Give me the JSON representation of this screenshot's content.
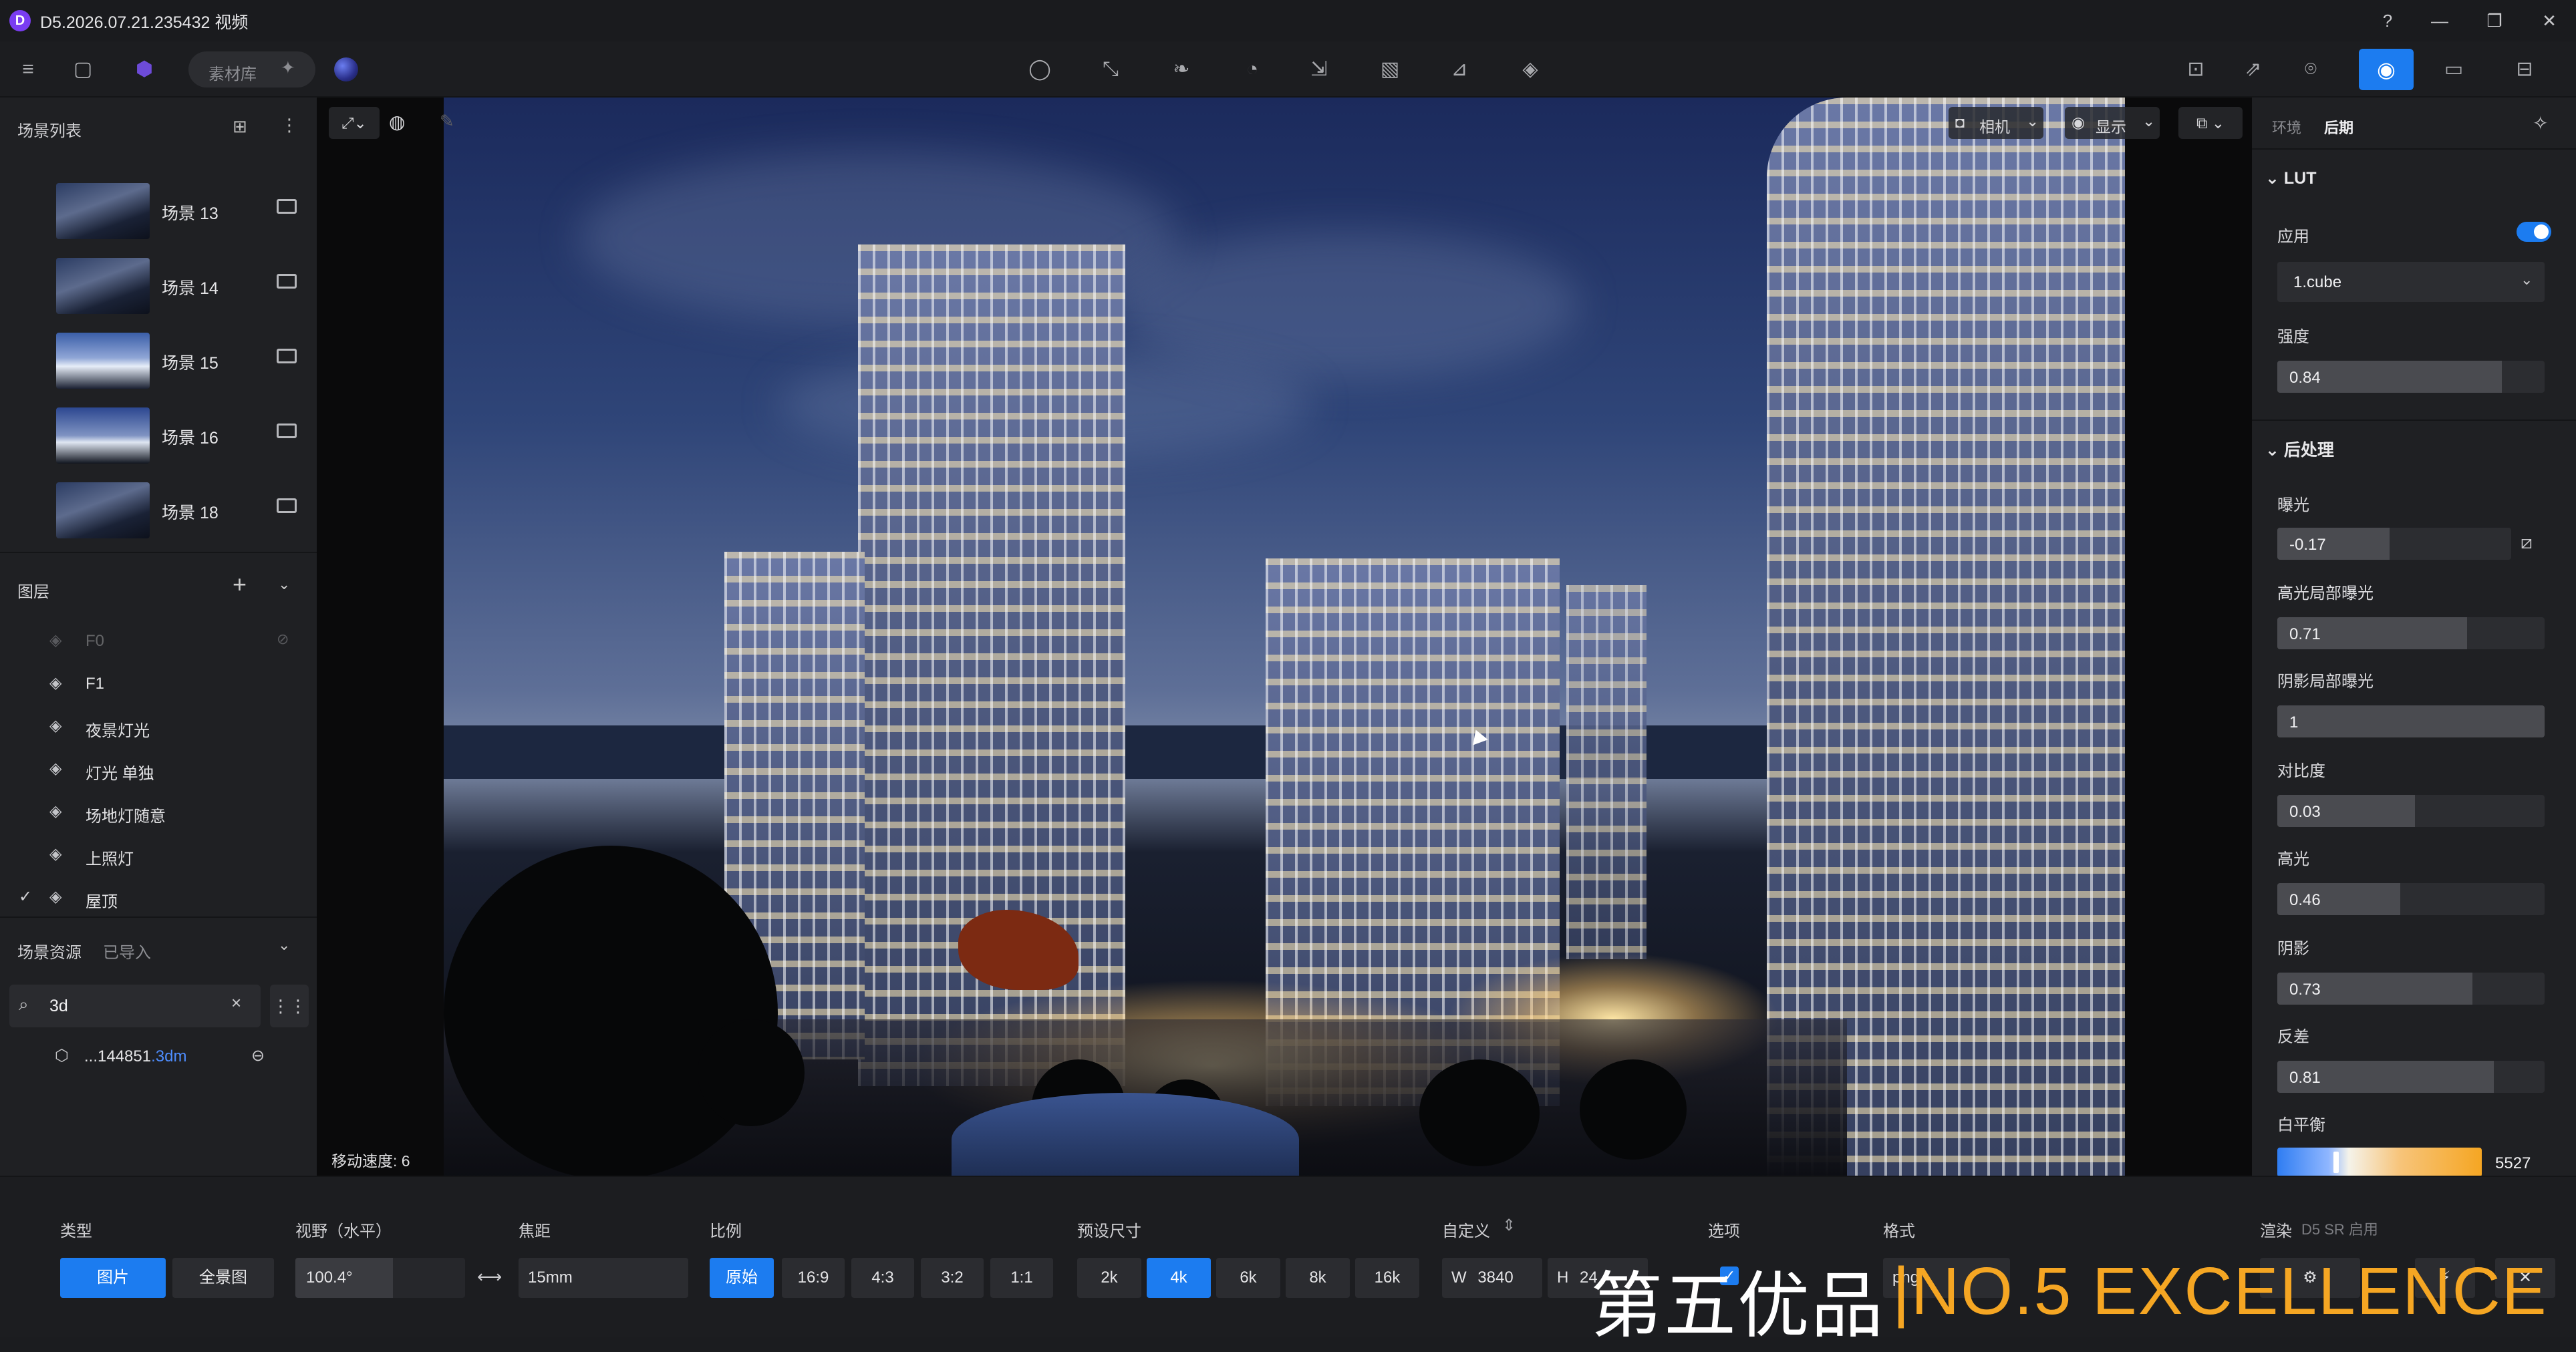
{
  "titlebar": {
    "app_logo": "D",
    "title": "D5.2026.07.21.235432 视频",
    "controls": [
      "?",
      "—",
      "❐",
      "✕"
    ]
  },
  "toolbar": {
    "material_label": "素材库",
    "left_icons": [
      "menu-icon",
      "file-icon",
      "cube-icon"
    ],
    "center_icons": [
      "bulb-icon",
      "path-icon",
      "leaf-icon",
      "fire-icon",
      "import-icon",
      "square-icon",
      "measure-icon",
      "layers-icon"
    ],
    "right_icons": [
      "vr-icon",
      "share-icon",
      "map-pin-icon",
      "camera-icon",
      "video-icon",
      "export-icon"
    ]
  },
  "scene_list": {
    "title": "场景列表",
    "items": [
      {
        "label": "场景 13"
      },
      {
        "label": "场景 14"
      },
      {
        "label": "场景 15"
      },
      {
        "label": "场景 16"
      },
      {
        "label": "场景 18"
      }
    ]
  },
  "layers": {
    "title": "图层",
    "items": [
      {
        "label": "F0",
        "dim": true
      },
      {
        "label": "F1"
      },
      {
        "label": "夜景灯光"
      },
      {
        "label": "灯光 单独"
      },
      {
        "label": "场地灯随意"
      },
      {
        "label": "上照灯"
      },
      {
        "label": "屋顶",
        "checked": true
      }
    ]
  },
  "assets": {
    "tab_scene": "场景资源",
    "tab_imported": "已导入",
    "search_value": "3d",
    "result_name": "...144851",
    "result_ext": ".3dm"
  },
  "viewport": {
    "camera_btn": "相机",
    "display_btn": "显示",
    "move_speed": "移动速度: 6"
  },
  "right_panel": {
    "tab_env": "环境",
    "tab_post": "后期",
    "lut_header": "LUT",
    "apply_label": "应用",
    "lut_file": "1.cube",
    "strength_label": "强度",
    "strength_value": "0.84",
    "post_header": "后处理",
    "params": [
      {
        "label": "曝光",
        "value": "-0.17",
        "fraction": 0.48
      },
      {
        "label": "高光局部曝光",
        "value": "0.71",
        "fraction": 0.71
      },
      {
        "label": "阴影局部曝光",
        "value": "1",
        "fraction": 1.0
      },
      {
        "label": "对比度",
        "value": "0.03",
        "fraction": 0.515
      },
      {
        "label": "高光",
        "value": "0.46",
        "fraction": 0.46
      },
      {
        "label": "阴影",
        "value": "0.73",
        "fraction": 0.73
      },
      {
        "label": "反差",
        "value": "0.81",
        "fraction": 0.81
      }
    ],
    "strength_fraction": 0.84,
    "wb_label": "白平衡",
    "wb_value": "5527"
  },
  "bottombar": {
    "type_label": "类型",
    "type_photo": "图片",
    "type_pano": "全景图",
    "fov_label": "视野（水平）",
    "fov_value": "100.4°",
    "focal_label": "焦距",
    "focal_value": "15mm",
    "ratio_label": "比例",
    "ratios": [
      "原始",
      "16:9",
      "4:3",
      "3:2",
      "1:1"
    ],
    "preset_label": "预设尺寸",
    "presets": [
      "2k",
      "4k",
      "6k",
      "8k",
      "16k"
    ],
    "custom_label": "自定义",
    "width_prefix": "W",
    "width_value": "3840",
    "height_prefix": "H",
    "height_value": "24",
    "options_label": "选项",
    "format_label": "格式",
    "format_value": "png",
    "render_label": "渲染",
    "render_note": "D5 SR 启用"
  },
  "watermark": {
    "cn": "第五优品",
    "en": "|NO.5 EXCELLENCE"
  },
  "colors": {
    "accent": "#1c7cf0",
    "watermark_orange": "#f5a623"
  }
}
